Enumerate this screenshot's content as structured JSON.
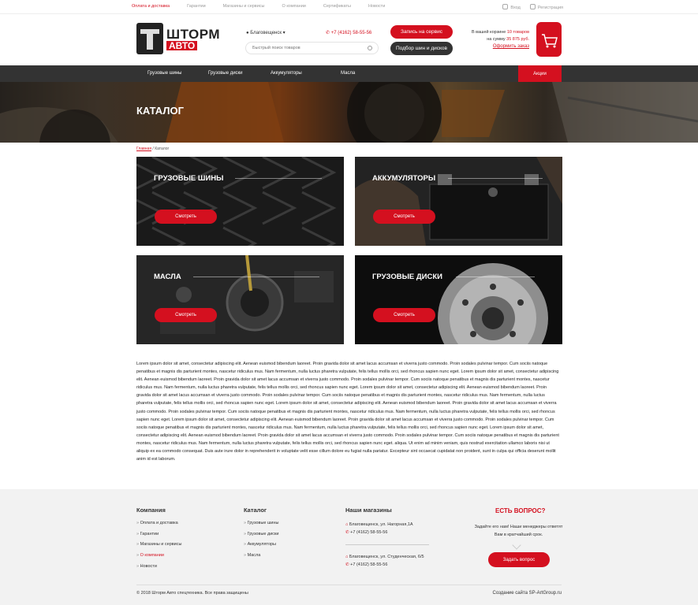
{
  "topbar": {
    "links": [
      "Оплата и доставка",
      "Гарантии",
      "Магазины и сервисы",
      "О компании",
      "Сертификаты",
      "Новости"
    ],
    "login": "Вход",
    "register": "Регистрация"
  },
  "header": {
    "logo_line1": "ШТОРМ",
    "logo_line2": "АВТО",
    "city": "Благовещенск",
    "phone": "+7 (4162) 58-55-56",
    "search_placeholder": "Быстрый поиск товаров",
    "btn_service": "Запись на сервис",
    "btn_tires": "Подбор шин и дисков",
    "cart_line1_prefix": "В вашей корзине",
    "cart_count": "10 товаров",
    "cart_line2_prefix": "на сумму",
    "cart_sum": "35 875 руб.",
    "cart_order": "Оформить заказ"
  },
  "nav": {
    "items": [
      "Грузовые шины",
      "Грузовые диски",
      "Аккумуляторы",
      "Масла"
    ],
    "promo": "Акции"
  },
  "hero": {
    "title": "КАТАЛОГ"
  },
  "breadcrumb": {
    "home": "Главная",
    "sep": " / ",
    "current": "Каталог"
  },
  "cards": [
    {
      "title": "ГРУЗОВЫЕ ШИНЫ",
      "button": "Смотреть"
    },
    {
      "title": "АККУМУЛЯТОРЫ",
      "button": "Смотреть"
    },
    {
      "title": "МАСЛА",
      "button": "Смотреть"
    },
    {
      "title": "ГРУЗОВЫЕ ДИСКИ",
      "button": "Смотреть"
    }
  ],
  "body_text": "Lorem ipsum dolor sit amet, consectetur adipiscing elit. Aenean euismod bibendum laoreet. Proin gravida dolor sit amet lacus accumsan et viverra justo commodo. Proin sodales pulvinar tempor. Cum sociis natoque penatibus et magnis dis parturient montes, nascetur ridiculus mus. Nam fermentum, nulla luctus pharetra vulputate, felis tellus mollis orci, sed rhoncus sapien nunc eget. Lorem ipsum dolor sit amet, consectetur adipiscing elit. Aenean euismod bibendum laoreet. Proin gravida dolor sit amet lacus accumsan et viverra justo commodo. Proin sodales pulvinar tempor. Cum sociis natoque penatibus et magnis dis parturient montes, nascetur ridiculus mus. Nam fermentum, nulla luctus pharetra vulputate, felis tellus mollis orci, sed rhoncus sapien nunc eget. Lorem ipsum dolor sit amet, consectetur adipiscing elit. Aenean euismod bibendum laoreet. Proin gravida dolor sit amet lacus accumsan et viverra justo commodo. Proin sodales pulvinar tempor. Cum sociis natoque penatibus et magnis dis parturient montes, nascetur ridiculus mus. Nam fermentum, nulla luctus pharetra vulputate, felis tellus mollis orci, sed rhoncus sapien nunc eget. Lorem ipsum dolor sit amet, consectetur adipiscing elit. Aenean euismod bibendum laoreet. Proin gravida dolor sit amet lacus accumsan et viverra justo commodo. Proin sodales pulvinar tempor. Cum sociis natoque penatibus et magnis dis parturient montes, nascetur ridiculus mus. Nam fermentum, nulla luctus pharetra vulputate, felis tellus mollis orci, sed rhoncus sapien nunc eget. Lorem ipsum dolor sit amet, consectetur adipiscing elit. Aenean euismod bibendum laoreet. Proin gravida dolor sit amet lacus accumsan et viverra justo commodo. Proin sodales pulvinar tempor. Cum sociis natoque penatibus et magnis dis parturient montes, nascetur ridiculus mus. Nam fermentum, nulla luctus pharetra vulputate, felis tellus mollis orci, sed rhoncus sapien nunc eget. Lorem ipsum dolor sit amet, consectetur adipiscing elit. Aenean euismod bibendum laoreet. Proin gravida dolor sit amet lacus accumsan et viverra justo commodo. Proin sodales pulvinar tempor. Cum sociis natoque penatibus et magnis dis parturient montes, nascetur ridiculus mus. Nam fermentum, nulla luctus pharetra vulputate, felis tellus mollis orci, sed rhoncus sapien nunc eget. aliqua. Ut enim ad minim veniam, quis nostrud exercitation ullamco laboris nisi ut aliquip ex ea commodo consequat. Duis aute irure dolor in reprehenderit in voluptate velit esse cillum dolore eu fugiat nulla pariatur. Excepteur sint occaecat cupidatat non proident, sunt in culpa qui officia deserunt mollit anim id est laborum.",
  "footer": {
    "company_title": "Компания",
    "company_items": [
      "Оплата и доставка",
      "Гарантии",
      "Магазины и сервисы",
      "О компании",
      "Новости"
    ],
    "catalog_title": "Каталог",
    "catalog_items": [
      "Грузовые шины",
      "Грузовые диски",
      "Аккумуляторы",
      "Масла"
    ],
    "shops_title": "Наши магазины",
    "shops": [
      {
        "address": "Благовещенск, ул. Нагорная,1А",
        "phone": "+7 (4162) 58-55-56"
      },
      {
        "address": "Благовещенск, ул. Студенческая, 6/5",
        "phone": "+7 (4162) 58-55-56"
      }
    ],
    "question_title": "ЕСТЬ ВОПРОС?",
    "question_text": "Задайте его нам! Наши менеджеры ответят Вам в кратчайший срок.",
    "question_button": "Задать вопрос",
    "copyright": "© 2018 Шторм Авто спецтехника. Все права защищены",
    "credit": "Создание сайта SP-ArtGroup.ru"
  },
  "colors": {
    "accent": "#d4101f",
    "nav_bg": "#333333",
    "footer_bg": "#f2f2f2"
  }
}
